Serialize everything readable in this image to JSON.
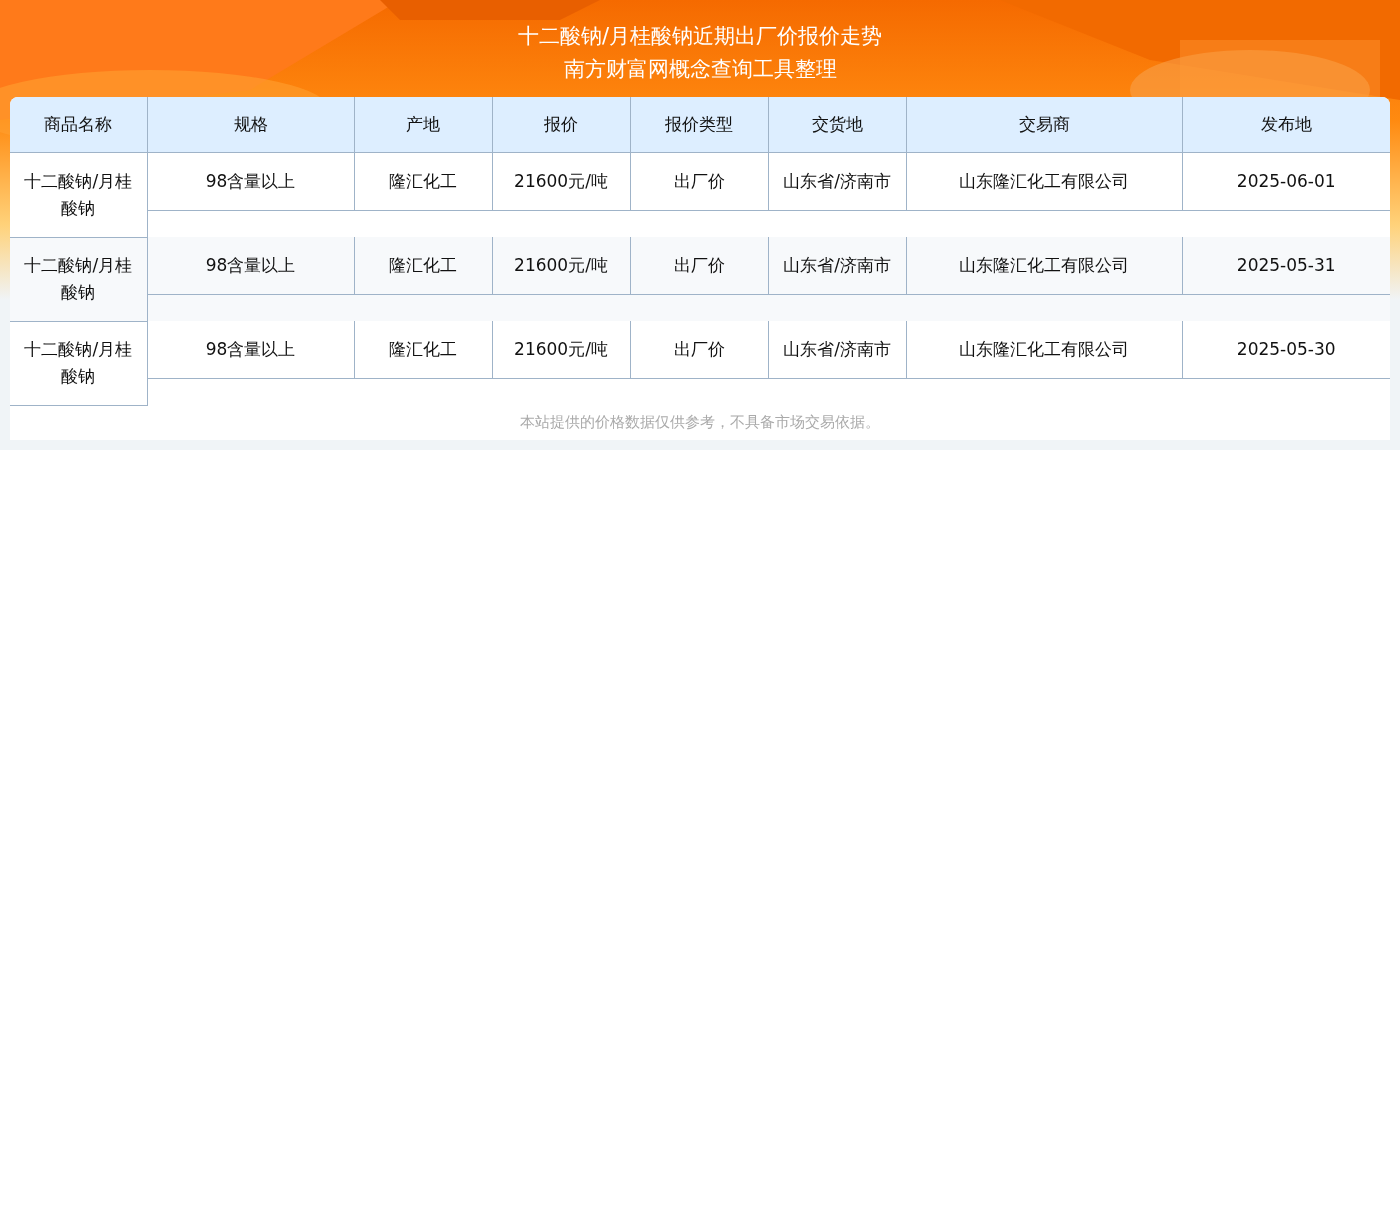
{
  "header": {
    "title": "十二酸钠/月桂酸钠近期出厂价报价走势",
    "subtitle": "南方财富网概念查询工具整理"
  },
  "table": {
    "columns": [
      "商品名称",
      "规格",
      "产地",
      "报价",
      "报价类型",
      "交货地",
      "交易商",
      "发布地"
    ],
    "rows": [
      [
        "十二酸钠/月桂酸钠",
        "98含量以上",
        "隆汇化工",
        "21600元/吨",
        "出厂价",
        "山东省/济南市",
        "山东隆汇化工有限公司",
        "2025-06-01"
      ],
      [
        "十二酸钠/月桂酸钠",
        "98含量以上",
        "隆汇化工",
        "21600元/吨",
        "出厂价",
        "山东省/济南市",
        "山东隆汇化工有限公司",
        "2025-05-31"
      ],
      [
        "十二酸钠/月桂酸钠",
        "98含量以上",
        "隆汇化工",
        "21600元/吨",
        "出厂价",
        "山东省/济南市",
        "山东隆汇化工有限公司",
        "2025-05-30"
      ]
    ]
  },
  "disclaimer": "本站提供的价格数据仅供参考，不具备市场交易依据。"
}
